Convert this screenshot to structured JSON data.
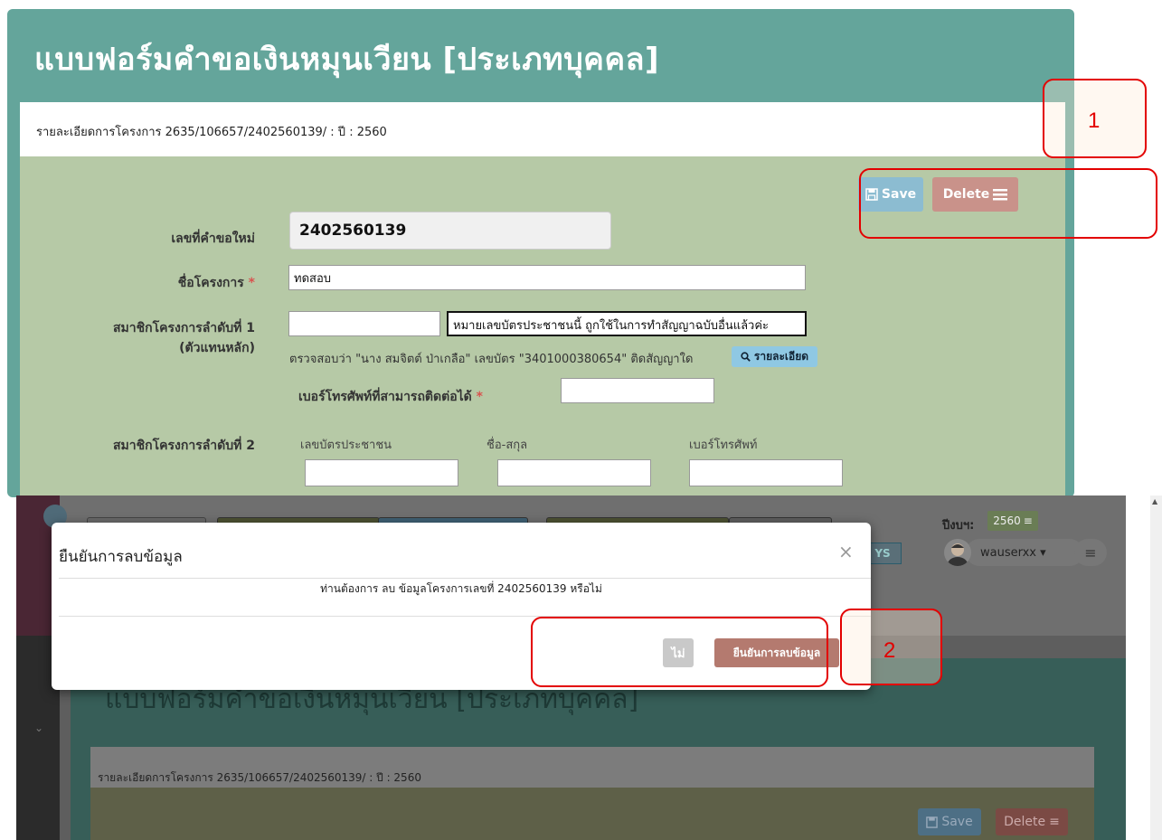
{
  "form": {
    "title": "แบบฟอร์มคำขอเงินหมุนเวียน [ประเภทบุคคล]",
    "detail_bar": "รายละเอียดการโครงการ 2635/106657/2402560139/ : ปี : 2560",
    "save_label": "Save",
    "delete_label": "Delete",
    "app_no_label": "เลขที่คำขอใหม่",
    "app_no_value": "2402560139",
    "project_name_label": "ชื่อโครงการ",
    "project_name_value": "ทดสอบ",
    "required_mark": "*",
    "member1_label_line1": "สมาชิกโครงการลำดับที่ 1",
    "member1_label_line2": "(ตัวแทนหลัก)",
    "member1_id_value": "",
    "member1_warning": "หมายเลขบัตรประชาชนนี้ ถูกใช้ในการทำสัญญาฉบับอื่นแล้วค่ะ",
    "verify_text": "ตรวจสอบว่า \"นาง สมจิตต์ ป่าเกลือ\" เลขบัตร \"3401000380654\" ติดสัญญาใด",
    "detail_button": "รายละเอียด",
    "phone_label": "เบอร์โทรศัพท์ที่สามารถติดต่อได้",
    "phone_value": "",
    "member2_label": "สมาชิกโครงการลำดับที่ 2",
    "member2_col_id": "เลขบัตรประชาชน",
    "member2_col_name": "ชื่อ-สกุล",
    "member2_col_phone": "เบอร์โทรศัพท์"
  },
  "annotations": {
    "one": "1",
    "two": "2"
  },
  "bottom_screen": {
    "year_label": "ปีงบฯ:",
    "year_value": "2560",
    "username": "wauserxx",
    "ys_badge": "YS",
    "title": "แบบฟอร์มคำขอเงินหมุนเวียน [ประเภทบุคคล]",
    "detail_bar": "รายละเอียดการโครงการ 2635/106657/2402560139/ : ปี : 2560",
    "save_label": "Save",
    "delete_label": "Delete"
  },
  "modal": {
    "title": "ยืนยันการลบข้อมูล",
    "close": "×",
    "body": "ท่านต้องการ ลบ ข้อมูลโครงการเลขที่ 2402560139 หรือไม่",
    "no_label": "ไม่",
    "confirm_label": "ยืนยันการลบข้อมูล"
  },
  "colors": {
    "panel_teal": "#64a59b",
    "form_green": "#b6c9a6",
    "save_blue": "#8cbcd1",
    "delete_red": "#c9928a",
    "annotation_red": "#e30000"
  }
}
